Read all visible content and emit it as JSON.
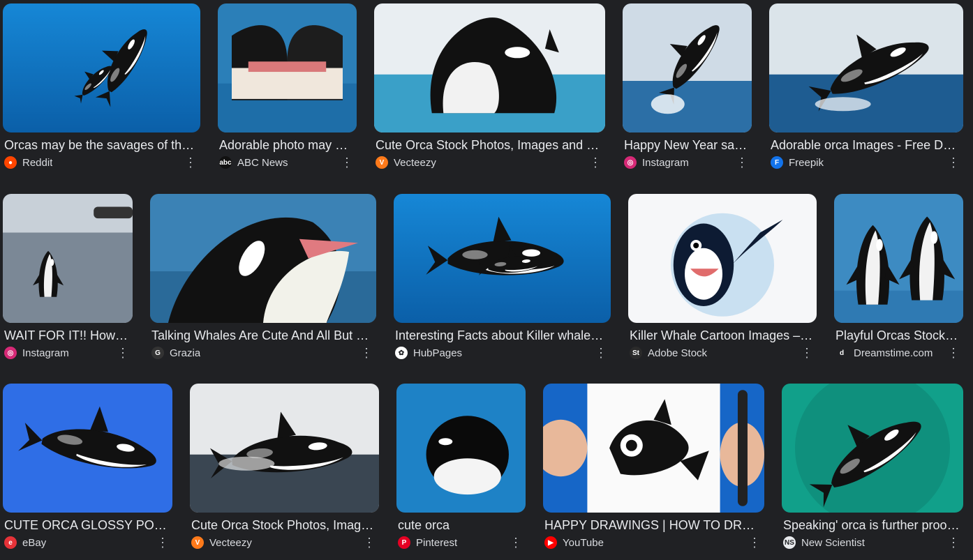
{
  "results": [
    {
      "title": "Orcas may be the savages of the…",
      "source": "Reddit",
      "favicon": "reddit-icon",
      "fav_color": "#ff4500",
      "fav_glyph": "●",
      "scene": "underwater"
    },
    {
      "title": "Adorable photo may s…",
      "source": "ABC News",
      "favicon": "abc-news-icon",
      "fav_color": "#111111",
      "fav_glyph": "abc",
      "scene": "kiss"
    },
    {
      "title": "Cute Orca Stock Photos, Images and B…",
      "source": "Vecteezy",
      "favicon": "vecteezy-icon",
      "fav_color": "#ff7a1a",
      "fav_glyph": "V",
      "scene": "pool"
    },
    {
      "title": "Happy New Year say…",
      "source": "Instagram",
      "favicon": "instagram-icon",
      "fav_color": "#d62976",
      "fav_glyph": "◎",
      "scene": "jump"
    },
    {
      "title": "Adorable orca Images - Free Do…",
      "source": "Freepik",
      "favicon": "freepik-icon",
      "fav_color": "#1273eb",
      "fav_glyph": "F",
      "scene": "breach"
    },
    {
      "title": "WAIT FOR IT!! How …",
      "source": "Instagram",
      "favicon": "instagram-icon",
      "fav_color": "#d62976",
      "fav_glyph": "◎",
      "scene": "boat"
    },
    {
      "title": "Talking Whales Are Cute And All But …",
      "source": "Grazia",
      "favicon": "grazia-icon",
      "fav_color": "#333333",
      "fav_glyph": "G",
      "scene": "talk"
    },
    {
      "title": "Interesting Facts about Killer whales …",
      "source": "HubPages",
      "favicon": "hubpages-icon",
      "fav_color": "#ffffff",
      "fav_glyph": "✿",
      "scene": "swim"
    },
    {
      "title": "Killer Whale Cartoon Images – …",
      "source": "Adobe Stock",
      "favicon": "adobe-stock-icon",
      "fav_color": "#2b2b2b",
      "fav_glyph": "St",
      "scene": "cartoon"
    },
    {
      "title": "Playful Orcas Stock I…",
      "source": "Dreamstime.com",
      "favicon": "dreamstime-icon",
      "fav_color": "#202124",
      "fav_glyph": "d",
      "scene": "duo"
    },
    {
      "title": "CUTE ORCA GLOSSY PO…",
      "source": "eBay",
      "favicon": "ebay-icon",
      "fav_color": "#e53238",
      "fav_glyph": "e",
      "scene": "glossy"
    },
    {
      "title": "Cute Orca Stock Photos, Image…",
      "source": "Vecteezy",
      "favicon": "vecteezy-icon",
      "fav_color": "#ff7a1a",
      "fav_glyph": "V",
      "scene": "splash"
    },
    {
      "title": "cute orca",
      "source": "Pinterest",
      "favicon": "pinterest-icon",
      "fav_color": "#e60023",
      "fav_glyph": "P",
      "scene": "head"
    },
    {
      "title": "HAPPY DRAWINGS | HOW TO DRA…",
      "source": "YouTube",
      "favicon": "youtube-icon",
      "fav_color": "#ff0000",
      "fav_glyph": "▶",
      "scene": "drawing"
    },
    {
      "title": "Speaking' orca is further proof…",
      "source": "New Scientist",
      "favicon": "new-scientist-icon",
      "fav_color": "#e8eaed",
      "fav_glyph": "NS",
      "scene": "green"
    }
  ],
  "more_icon": "more-vert-icon",
  "more_glyph": "⋮"
}
